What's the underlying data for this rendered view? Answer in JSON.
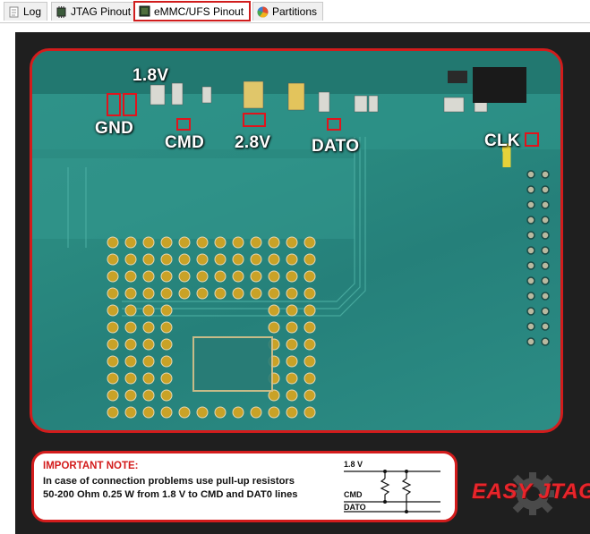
{
  "tabs": [
    {
      "label": "Log",
      "icon": "log-icon"
    },
    {
      "label": "JTAG Pinout",
      "icon": "jtag-chip-icon"
    },
    {
      "label": "eMMC/UFS Pinout",
      "icon": "emmc-chip-icon",
      "active": true
    },
    {
      "label": "Partitions",
      "icon": "partitions-pie-icon"
    }
  ],
  "board": {
    "labels": {
      "v18": "1.8V",
      "gnd": "GND",
      "cmd": "CMD",
      "v28": "2.8V",
      "dat0": "DATO",
      "clk": "CLK"
    }
  },
  "note": {
    "title": "IMPORTANT NOTE:",
    "line1": "In case of connection problems use pull-up resistors",
    "line2": "50-200 Ohm 0.25 W from 1.8 V to CMD and DAT0 lines",
    "schematic": {
      "v18": "1.8 V",
      "cmd": "CMD",
      "dat0": "DATO"
    }
  },
  "brand": "EASY JTAG",
  "colors": {
    "accent_red": "#d31c1c",
    "board_green": "#2a8a80",
    "pad_gold": "#c9a227"
  }
}
